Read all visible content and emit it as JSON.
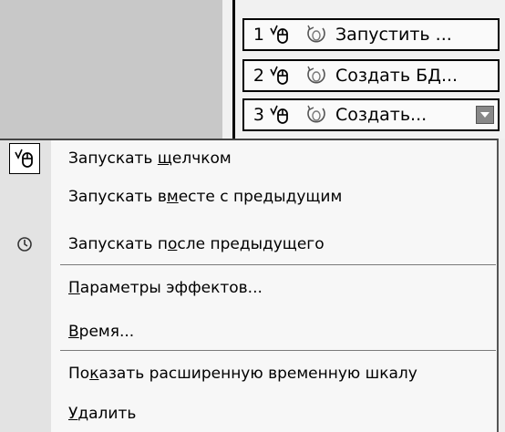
{
  "animation_list": [
    {
      "number": "1",
      "label": "Запустить ...",
      "click_icon": "mouse-click-icon",
      "effect_icon": "spin-effect-icon"
    },
    {
      "number": "2",
      "label": "Создать БД...",
      "click_icon": "mouse-click-icon",
      "effect_icon": "spin-effect-icon"
    },
    {
      "number": "3",
      "label": "Создать...",
      "click_icon": "mouse-click-icon",
      "effect_icon": "spin-effect-icon",
      "dropdown_icon": "chevron-down-icon"
    }
  ],
  "context_menu": {
    "items": [
      {
        "pre": "Запускать ",
        "ul": "щ",
        "post": "елчком",
        "icon": "mouse-click-icon",
        "checked": true
      },
      {
        "pre": "Запускать в",
        "ul": "м",
        "post": "есте с предыдущим",
        "icon": "",
        "checked": false
      },
      {
        "pre": "Запускать п",
        "ul": "о",
        "post": "сле предыдущего",
        "icon": "clock-icon",
        "checked": false
      },
      {
        "pre": "",
        "ul": "П",
        "post": "араметры эффектов...",
        "icon": "",
        "checked": false
      },
      {
        "pre": "",
        "ul": "В",
        "post": "ремя...",
        "icon": "",
        "checked": false
      },
      {
        "pre": "По",
        "ul": "к",
        "post": "азать расширенную временную шкалу",
        "icon": "",
        "checked": false
      },
      {
        "pre": "",
        "ul": "У",
        "post": "далить",
        "icon": "",
        "checked": false
      }
    ]
  }
}
